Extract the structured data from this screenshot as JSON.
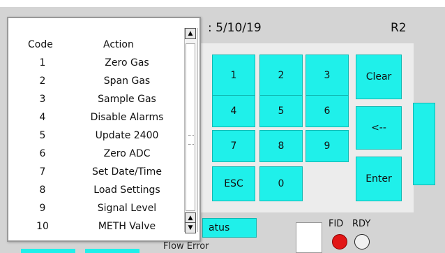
{
  "header": {
    "date_text": ": 5/10/19",
    "revision": "R2"
  },
  "keypad": {
    "keys": [
      "1",
      "2",
      "3",
      "4",
      "5",
      "6",
      "7",
      "8",
      "9",
      "ESC",
      "0"
    ],
    "clear_label": "Clear",
    "back_label": "<--",
    "enter_label": "Enter"
  },
  "status": {
    "status_button_label": "atus",
    "flow_error_text": "Flow Error",
    "fid_label": "FID",
    "rdy_label": "RDY",
    "fid_color": "#e21616"
  },
  "popup": {
    "header_code": "Code",
    "header_action": "Action",
    "rows": [
      {
        "code": "1",
        "action": "Zero Gas"
      },
      {
        "code": "2",
        "action": "Span Gas"
      },
      {
        "code": "3",
        "action": "Sample Gas"
      },
      {
        "code": "4",
        "action": "Disable Alarms"
      },
      {
        "code": "5",
        "action": "Update 2400"
      },
      {
        "code": "6",
        "action": "Zero ADC"
      },
      {
        "code": "7",
        "action": "Set Date/Time"
      },
      {
        "code": "8",
        "action": "Load Settings"
      },
      {
        "code": "9",
        "action": "Signal Level"
      },
      {
        "code": "10",
        "action": "METH Valve"
      }
    ]
  },
  "colors": {
    "key_cyan": "#1ff0ea",
    "panel_bg": "#ececec"
  }
}
